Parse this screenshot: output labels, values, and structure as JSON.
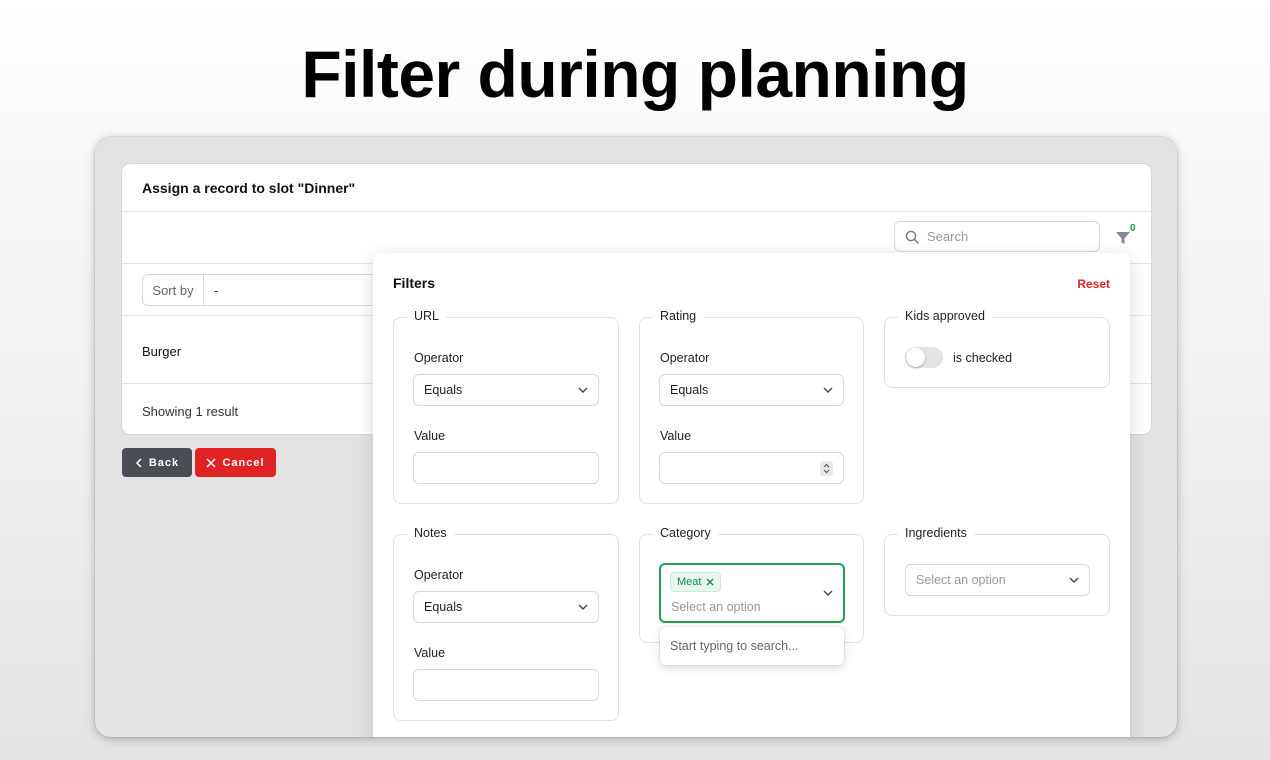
{
  "headline": "Filter during planning",
  "modal": {
    "title": "Assign a record to slot \"Dinner\"",
    "search_placeholder": "Search",
    "filter_count": "0",
    "sort_label": "Sort by",
    "sort_value": "-",
    "records": [
      "Burger"
    ],
    "showing": "Showing 1 result",
    "back_label": "Back",
    "cancel_label": "Cancel"
  },
  "filters": {
    "title": "Filters",
    "reset_label": "Reset",
    "url": {
      "legend": "URL",
      "operator_label": "Operator",
      "operator_value": "Equals",
      "value_label": "Value",
      "value": ""
    },
    "rating": {
      "legend": "Rating",
      "operator_label": "Operator",
      "operator_value": "Equals",
      "value_label": "Value",
      "value": ""
    },
    "kids": {
      "legend": "Kids approved",
      "toggle_label": "is checked",
      "checked": false
    },
    "notes": {
      "legend": "Notes",
      "operator_label": "Operator",
      "operator_value": "Equals",
      "value_label": "Value",
      "value": ""
    },
    "category": {
      "legend": "Category",
      "tag": "Meat",
      "placeholder": "Select an option",
      "dropdown_hint": "Start typing to search..."
    },
    "ingredients": {
      "legend": "Ingredients",
      "placeholder": "Select an option"
    }
  },
  "colors": {
    "accent_green": "#1ea451",
    "danger": "#e02424",
    "back_button": "#4b4d55"
  }
}
